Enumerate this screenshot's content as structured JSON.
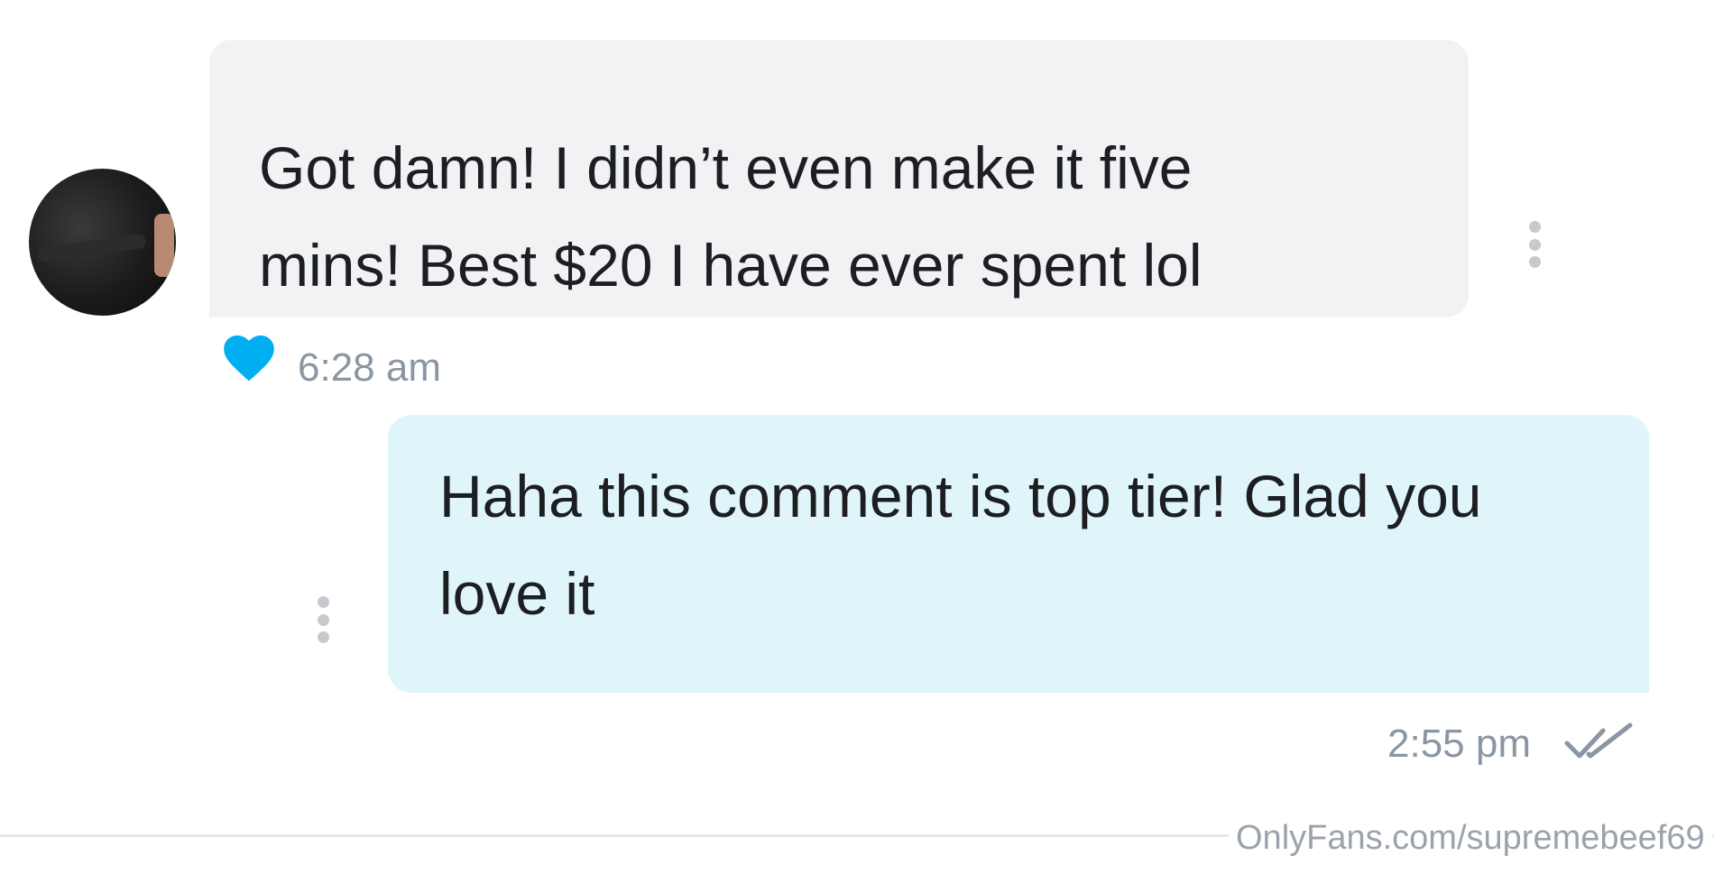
{
  "messages": [
    {
      "direction": "received",
      "lines": [
        "Got damn! I didn’t even make it five",
        "mins! Best $20 I have ever spent lol"
      ],
      "time": "6:28 am",
      "liked": true
    },
    {
      "direction": "sent",
      "lines": [
        "Haha this comment is top tier! Glad you",
        "love it"
      ],
      "time": "2:55 pm",
      "status_icon": "double-check-icon"
    }
  ],
  "watermark": "OnlyFans.com/supremebeef69",
  "colors": {
    "received_bubble": "#f0f2f3",
    "sent_bubble": "#dff5fa",
    "heart": "#00aff0",
    "timestamp": "#8a96a3"
  }
}
